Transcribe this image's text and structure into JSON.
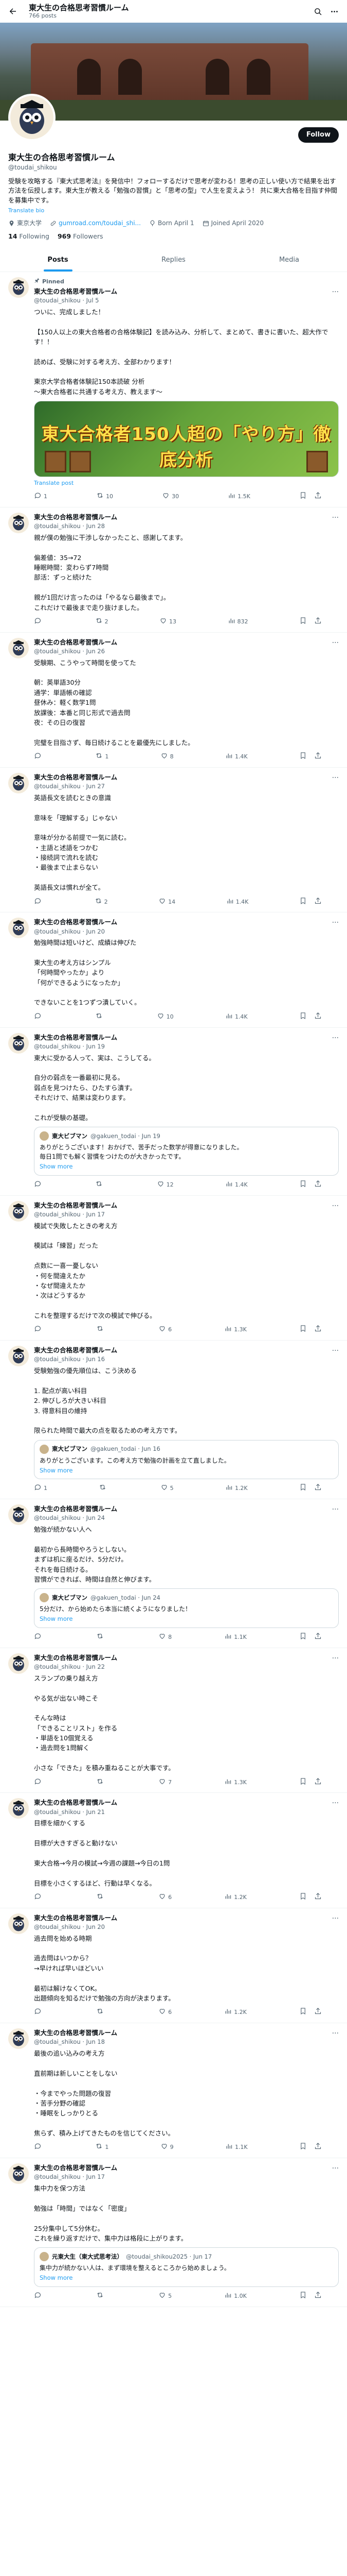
{
  "header": {
    "title": "東大生の合格思考習慣ルーム",
    "subtitle": "766 posts"
  },
  "profile": {
    "name": "東大生の合格思考習慣ルーム",
    "handle": "@toudai_shikou",
    "follow_label": "Follow",
    "bio": "受験を攻略する『東大式思考法』を発信中！フォローするだけで思考が変わる！思考の正しい使い方で結果を出す方法を伝授します。東大生が教える「勉強の習慣」と「思考の型」で人生を変えよう！ 共に東大合格を目指す仲間を募集中です。",
    "translate_label": "Translate bio",
    "location": "東京大学",
    "link": "gumroad.com/toudai_shi...",
    "birthday": "Born April 1",
    "joined": "Joined April 2020",
    "following_count": "14",
    "following_label": "Following",
    "followers_count": "969",
    "followers_label": "Followers"
  },
  "tabs": [
    "Posts",
    "Replies",
    "Media"
  ],
  "tweets": [
    {
      "pinned_label": "Pinned",
      "name": "東大生の合格思考習慣ルーム",
      "meta": "@toudai_shikou · Jul 5",
      "text": "ついに、完成しました！\n\n【150人以上の東大合格者の合格体験記】を読み込み、分析して、まとめて、書きに書いた、超大作です！！\n\n読めば、受験に対する考え方、全部わかります！\n\n東京大学合格者体験記150本読破 分析\n〜東大合格者に共通する考え方、教えます〜",
      "media_title": "東大合格者150人超の「やり方」徹底分析",
      "translate": "Translate post",
      "stats": {
        "reply": "1",
        "retweet": "10",
        "like": "30",
        "views": "1.5K"
      }
    },
    {
      "name": "東大生の合格思考習慣ルーム",
      "meta": "@toudai_shikou · Jun 28",
      "text": "親が僕の勉強に干渉しなかったこと、感謝してます。\n\n偏差値：35→72\n睡眠時間：変わらず7時間\n部活：ずっと続けた\n\n親が1回だけ言ったのは「やるなら最後まで」。\nこれだけで最後まで走り抜けました。",
      "translate": "",
      "stats": {
        "reply": "",
        "retweet": "2",
        "like": "13",
        "views": "832"
      }
    },
    {
      "name": "東大生の合格思考習慣ルーム",
      "meta": "@toudai_shikou · Jun 26",
      "text": "受験期、こうやって時間を使ってた\n\n朝：英単語30分\n通学：単語帳の確認\n昼休み：軽く数学1問\n放課後：本番と同じ形式で過去問\n夜：その日の復習\n\n完璧を目指さず、毎日続けることを最優先にしました。",
      "translate": "",
      "stats": {
        "reply": "",
        "retweet": "1",
        "like": "8",
        "views": "1.4K"
      }
    },
    {
      "name": "東大生の合格思考習慣ルーム",
      "meta": "@toudai_shikou · Jun 27",
      "text": "英語長文を読むときの意識\n\n意味を「理解する」じゃない\n\n意味が分かる前提で一気に読む。\n・主語と述語をつかむ\n・接続詞で流れを読む\n・最後まで止まらない\n\n英語長文は慣れが全て。",
      "translate": "",
      "stats": {
        "reply": "",
        "retweet": "2",
        "like": "14",
        "views": "1.4K"
      }
    },
    {
      "name": "東大生の合格思考習慣ルーム",
      "meta": "@toudai_shikou · Jun 20",
      "text": "勉強時間は短いけど、成績は伸びた\n\n東大生の考え方はシンプル\n「何時間やったか」より\n「何ができるようになったか」\n\nできないことを1つずつ潰していく。",
      "translate": "",
      "stats": {
        "reply": "",
        "retweet": "",
        "like": "10",
        "views": "1.4K"
      }
    },
    {
      "name": "東大生の合格思考習慣ルーム",
      "meta": "@toudai_shikou · Jun 19",
      "text": "東大に受かる人って、実は、こうしてる。\n\n自分の弱点を一番最初に見る。\n弱点を見つけたら、ひたすら潰す。\nそれだけで、結果は変わります。\n\nこれが受験の基礎。",
      "quote": {
        "name": "東大ビブマン",
        "meta": "@gakuen_todai · Jun 19",
        "text": "ありがとうございます！おかげで、苦手だった数学が得意になりました。\n毎日1問でも解く習慣をつけたのが大きかったです。",
        "more": "Show more"
      },
      "translate": "",
      "stats": {
        "reply": "",
        "retweet": "",
        "like": "12",
        "views": "1.4K"
      }
    },
    {
      "name": "東大生の合格思考習慣ルーム",
      "meta": "@toudai_shikou · Jun 17",
      "text": "模試で失敗したときの考え方\n\n模試は「練習」だった\n\n点数に一喜一憂しない\n・何を間違えたか\n・なぜ間違えたか\n・次はどうするか\n\nこれを整理するだけで次の模試で伸びる。",
      "translate": "",
      "stats": {
        "reply": "",
        "retweet": "",
        "like": "6",
        "views": "1.3K"
      }
    },
    {
      "name": "東大生の合格思考習慣ルーム",
      "meta": "@toudai_shikou · Jun 16",
      "text": "受験勉強の優先順位は、こう決める\n\n1. 配点が高い科目\n2. 伸びしろが大きい科目\n3. 得意科目の維持\n\n限られた時間で最大の点を取るための考え方です。",
      "quote": {
        "name": "東大ビブマン",
        "meta": "@gakuen_todai · Jun 16",
        "text": "ありがとうございます。この考え方で勉強の計画を立て直しました。",
        "more": "Show more"
      },
      "translate": "",
      "stats": {
        "reply": "1",
        "retweet": "",
        "like": "5",
        "views": "1.2K"
      }
    },
    {
      "name": "東大生の合格思考習慣ルーム",
      "meta": "@toudai_shikou · Jun 24",
      "text": "勉強が続かない人へ\n\n最初から長時間やろうとしない。\nまずは机に座るだけ、5分だけ。\nそれを毎日続ける。\n習慣ができれば、時間は自然と伸びます。",
      "quote": {
        "name": "東大ビブマン",
        "meta": "@gakuen_todai · Jun 24",
        "text": "5分だけ、から始めたら本当に続くようになりました！",
        "more": "Show more"
      },
      "translate": "",
      "stats": {
        "reply": "",
        "retweet": "",
        "like": "8",
        "views": "1.1K"
      }
    },
    {
      "name": "東大生の合格思考習慣ルーム",
      "meta": "@toudai_shikou · Jun 22",
      "text": "スランプの乗り越え方\n\nやる気が出ない時こそ\n\nそんな時は\n「できることリスト」を作る\n・単語を10個覚える\n・過去問を1問解く\n\n小さな「できた」を積み重ねることが大事です。",
      "translate": "",
      "stats": {
        "reply": "",
        "retweet": "",
        "like": "7",
        "views": "1.3K"
      }
    },
    {
      "name": "東大生の合格思考習慣ルーム",
      "meta": "@toudai_shikou · Jun 21",
      "text": "目標を細かくする\n\n目標が大きすぎると動けない\n\n東大合格→今月の模試→今週の課題→今日の1問\n\n目標を小さくするほど、行動は早くなる。",
      "translate": "",
      "stats": {
        "reply": "",
        "retweet": "",
        "like": "6",
        "views": "1.2K"
      }
    },
    {
      "name": "東大生の合格思考習慣ルーム",
      "meta": "@toudai_shikou · Jun 20",
      "text": "過去問を始める時期\n\n過去問はいつから？\n→早ければ早いほどいい\n\n最初は解けなくてOK。\n出題傾向を知るだけで勉強の方向が決まります。",
      "translate": "",
      "stats": {
        "reply": "",
        "retweet": "",
        "like": "6",
        "views": "1.2K"
      }
    },
    {
      "name": "東大生の合格思考習慣ルーム",
      "meta": "@toudai_shikou · Jun 18",
      "text": "最後の追い込みの考え方\n\n直前期は新しいことをしない\n\n・今までやった問題の復習\n・苦手分野の確認\n・睡眠をしっかりとる\n\n焦らず、積み上げてきたものを信じてください。",
      "translate": "",
      "stats": {
        "reply": "",
        "retweet": "1",
        "like": "9",
        "views": "1.1K"
      }
    },
    {
      "name": "東大生の合格思考習慣ルーム",
      "meta": "@toudai_shikou · Jun 17",
      "text": "集中力を保つ方法\n\n勉強は「時間」ではなく「密度」\n\n25分集中して5分休む。\nこれを繰り返すだけで、集中力は格段に上がります。",
      "quote": {
        "name": "元東大生（東大式思考法）",
        "meta": "@toudai_shikou2025 · Jun 17",
        "text": "集中力が続かない人は、まず環境を整えるところから始めましょう。",
        "more": "Show more"
      },
      "translate": "",
      "stats": {
        "reply": "",
        "retweet": "",
        "like": "5",
        "views": "1.0K"
      }
    }
  ]
}
